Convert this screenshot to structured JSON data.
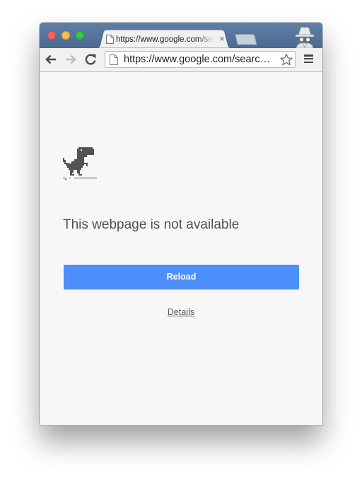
{
  "window": {
    "traffic_lights": [
      "close",
      "minimize",
      "zoom"
    ]
  },
  "tab": {
    "title": "https://www.google.com/search",
    "favicon": "page-icon",
    "close_glyph": "×"
  },
  "toolbar": {
    "back_icon": "arrow-left-icon",
    "forward_icon": "arrow-right-icon",
    "reload_icon": "reload-icon",
    "url": "https://www.google.com/searc…",
    "bookmark_icon": "star-outline-icon",
    "menu_icon": "hamburger-icon"
  },
  "profile": {
    "icon": "incognito-icon"
  },
  "error_page": {
    "icon": "dinosaur-icon",
    "title": "This webpage is not available",
    "reload_label": "Reload",
    "details_label": "Details"
  },
  "colors": {
    "tabstrip": "#5a7aa3",
    "primary_button": "#4c8efa",
    "page_background": "#f7f7f7"
  }
}
